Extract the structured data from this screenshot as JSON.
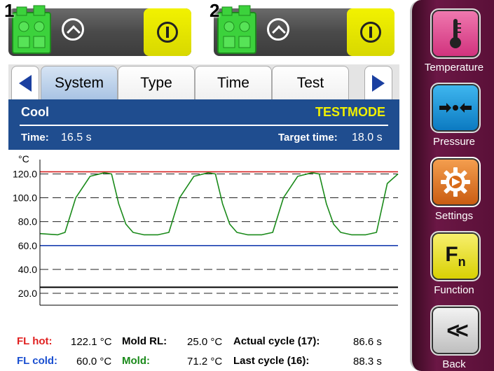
{
  "units": [
    {
      "number": "1",
      "machine_icon": "temperature-control-unit-icon",
      "status_icon": "chevron-up-circle-icon",
      "power_icon": "power-icon"
    },
    {
      "number": "2",
      "machine_icon": "temperature-control-unit-icon",
      "status_icon": "chevron-up-circle-icon",
      "power_icon": "power-icon"
    }
  ],
  "tabs": {
    "items": [
      "System",
      "Type",
      "Time",
      "Test"
    ],
    "active": "System",
    "prev_icon": "arrow-left-icon",
    "next_icon": "arrow-right-icon"
  },
  "header": {
    "title": "Cool",
    "mode": "TESTMODE",
    "time_label": "Time:",
    "time_value": "16.5 s",
    "target_label": "Target time:",
    "target_value": "18.0 s"
  },
  "chart_data": {
    "type": "line",
    "ylabel": "°C",
    "yticks": [
      "120.0",
      "100.0",
      "80.0",
      "60.0",
      "40.0",
      "20.0"
    ],
    "ylim": [
      10,
      132
    ],
    "xlim": [
      0,
      100
    ],
    "grid": "dashed horizontal",
    "series": [
      {
        "color": "#d42020",
        "x": [
          0,
          100
        ],
        "y": [
          121.8,
          121.8
        ]
      },
      {
        "color": "#1a3fb0",
        "x": [
          0,
          100
        ],
        "y": [
          60.0,
          60.0
        ]
      },
      {
        "color": "#000000",
        "x": [
          0,
          100
        ],
        "y": [
          25.0,
          25.0
        ]
      },
      {
        "color": "#1a8a1a",
        "x": [
          0,
          5,
          7,
          10,
          14,
          18,
          20,
          22,
          24,
          26,
          29,
          33,
          36,
          39,
          43,
          47,
          49,
          51,
          53,
          55,
          58,
          62,
          65,
          68,
          72,
          76,
          78,
          80,
          82,
          84,
          87,
          91,
          94,
          97,
          100
        ],
        "y": [
          70,
          69,
          71,
          100,
          118,
          121,
          120,
          95,
          78,
          71,
          69,
          69,
          71,
          100,
          118,
          121,
          120,
          95,
          78,
          71,
          69,
          69,
          71,
          100,
          118,
          121,
          120,
          95,
          78,
          71,
          69,
          69,
          71,
          112,
          120
        ]
      }
    ]
  },
  "footer": {
    "fl_hot_label": "FL hot:",
    "fl_hot_value": "122.1 °C",
    "fl_cold_label": "FL cold:",
    "fl_cold_value": "60.0 °C",
    "mold_rl_label": "Mold RL:",
    "mold_rl_value": "25.0 °C",
    "mold_label": "Mold:",
    "mold_value": "71.2 °C",
    "actual_cycle_label": "Actual cycle (17):",
    "actual_cycle_value": "86.6 s",
    "last_cycle_label": "Last cycle (16):",
    "last_cycle_value": "88.3 s",
    "colors": {
      "hot": "#e02020",
      "cold": "#1a4fd0",
      "mold": "#1a8a1a"
    }
  },
  "sidebar": {
    "items": [
      {
        "label": "Temperature",
        "icon": "thermometer-icon"
      },
      {
        "label": "Pressure",
        "icon": "pressure-arrows-icon"
      },
      {
        "label": "Settings",
        "icon": "gear-icon"
      },
      {
        "label": "Function",
        "icon": "function-fn-icon",
        "glyph": "F",
        "sub": "n"
      },
      {
        "label": "Back",
        "icon": "back-double-chevron-icon",
        "glyph": "<<"
      }
    ]
  }
}
